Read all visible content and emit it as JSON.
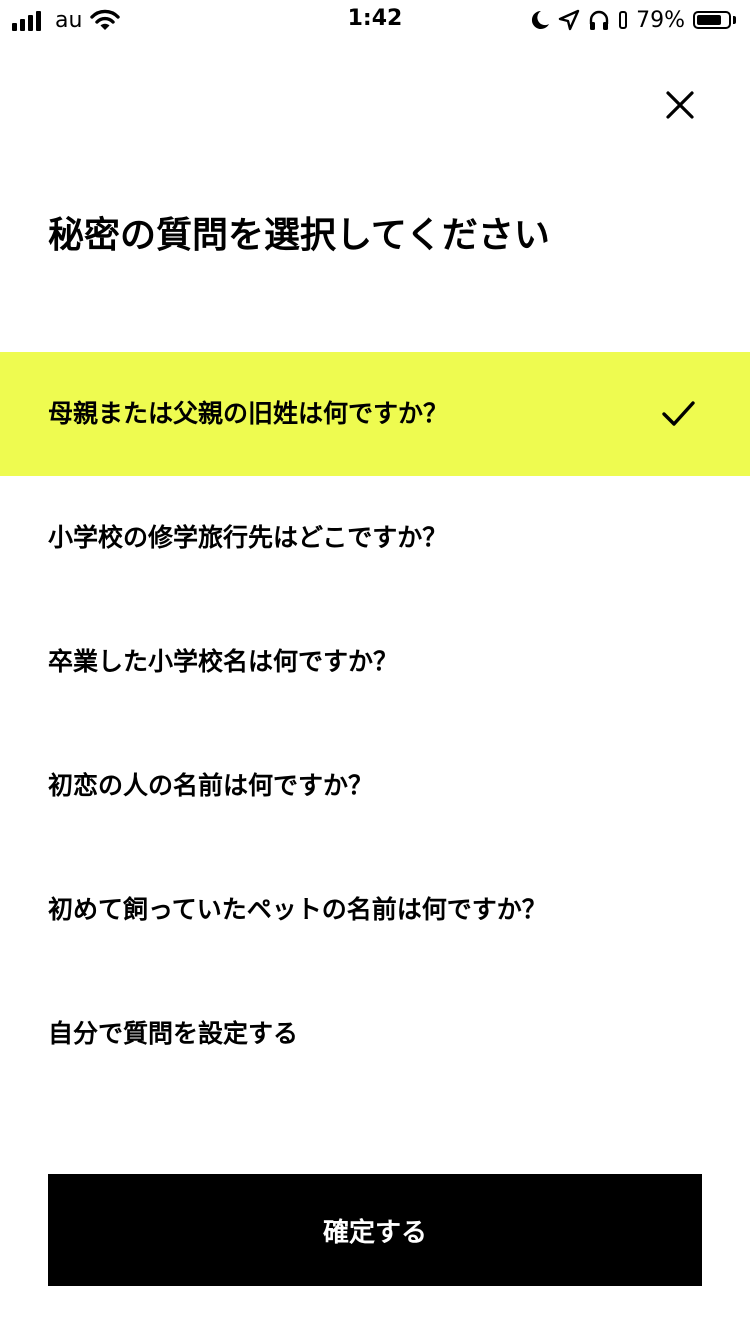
{
  "status_bar": {
    "carrier": "au",
    "time": "1:42",
    "battery_percent": "79%",
    "battery_level": 0.79,
    "icons": [
      "signal-icon",
      "wifi-icon",
      "moon-icon",
      "location-icon",
      "headphones-icon",
      "rotation-lock-icon",
      "battery-icon"
    ]
  },
  "header": {
    "close_icon": "close-icon",
    "title": "秘密の質問を選択してください"
  },
  "questions": [
    {
      "label": "母親または父親の旧姓は何ですか？",
      "selected": true
    },
    {
      "label": "小学校の修学旅行先はどこですか？",
      "selected": false
    },
    {
      "label": "卒業した小学校名は何ですか？",
      "selected": false
    },
    {
      "label": "初恋の人の名前は何ですか？",
      "selected": false
    },
    {
      "label": "初めて飼っていたペットの名前は何ですか？",
      "selected": false
    },
    {
      "label": "自分で質問を設定する",
      "selected": false
    }
  ],
  "selected_icon": "checkmark-icon",
  "confirm_button": {
    "label": "確定する"
  },
  "colors": {
    "selected_background": "#eefb50",
    "text": "#000000",
    "button_background": "#000000",
    "button_text": "#ffffff"
  }
}
